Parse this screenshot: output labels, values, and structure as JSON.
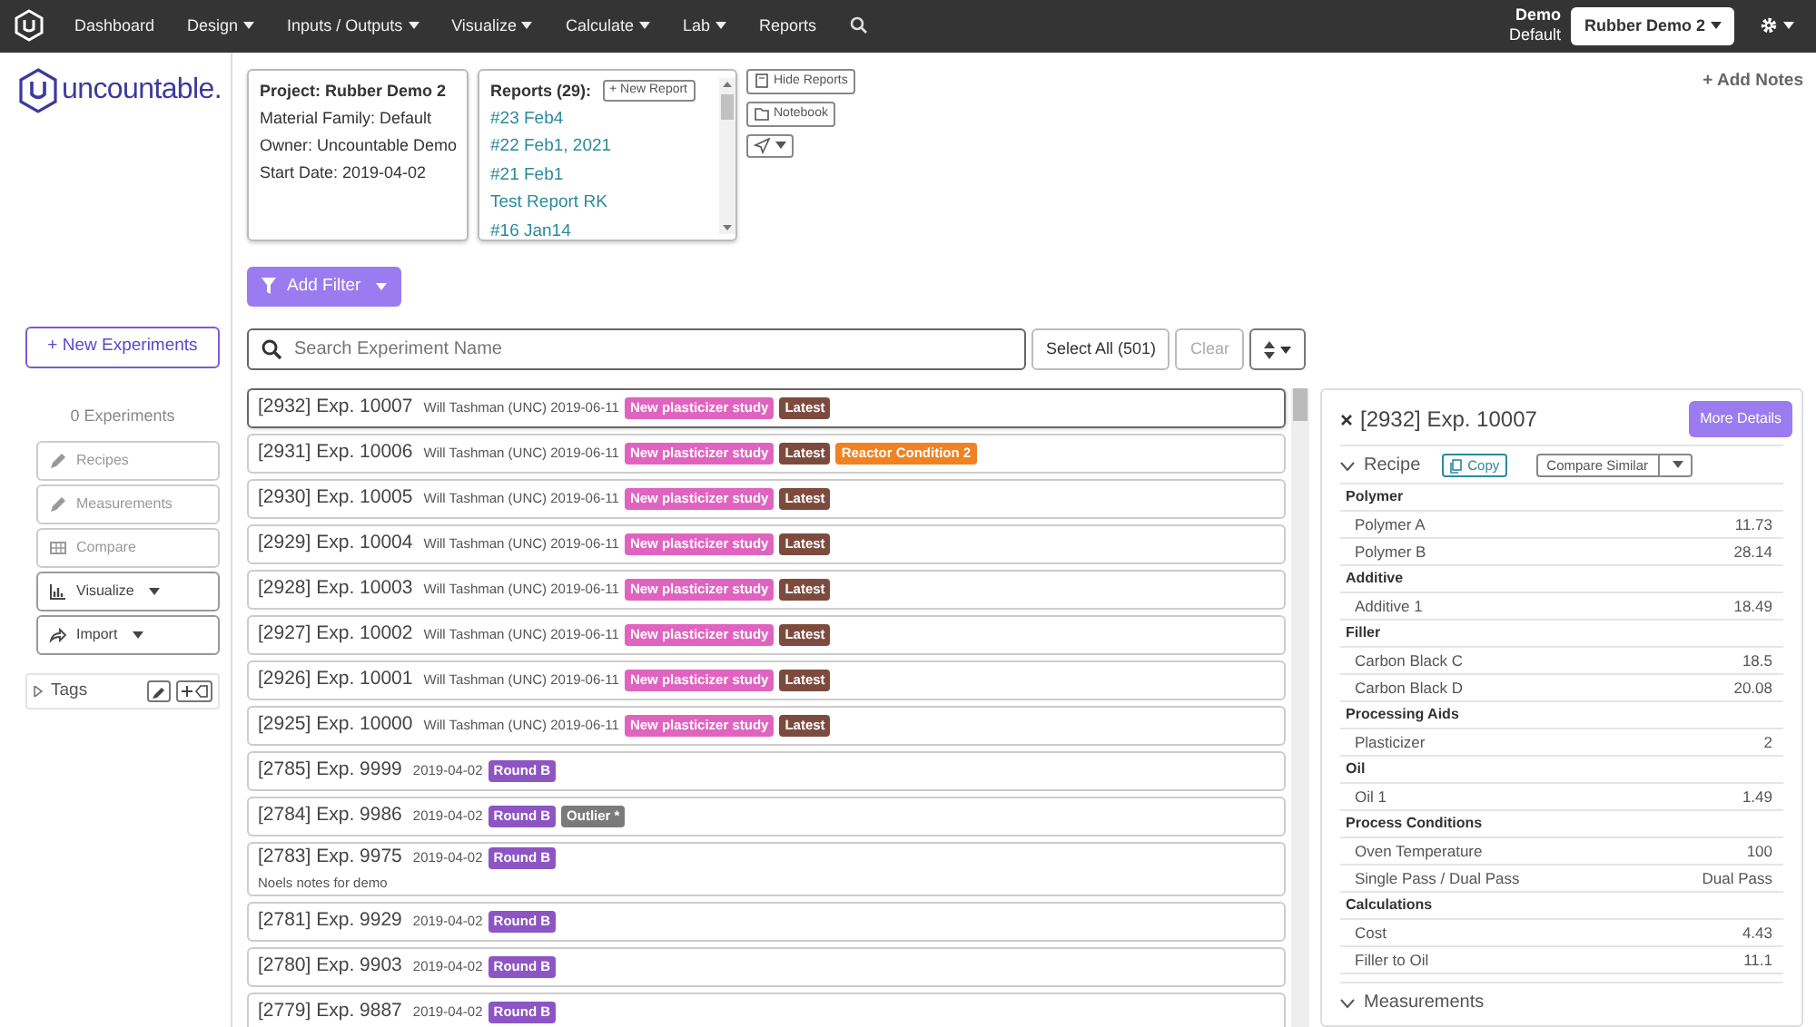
{
  "navbar": {
    "items": [
      {
        "label": "Dashboard",
        "dropdown": false
      },
      {
        "label": "Design",
        "dropdown": true
      },
      {
        "label": "Inputs / Outputs",
        "dropdown": true
      },
      {
        "label": "Visualize",
        "dropdown": true
      },
      {
        "label": "Calculate",
        "dropdown": true
      },
      {
        "label": "Lab",
        "dropdown": true
      },
      {
        "label": "Reports",
        "dropdown": false
      }
    ],
    "user": {
      "name": "Demo",
      "org": "Default"
    },
    "project_select": "Rubber Demo 2"
  },
  "logo": {
    "text": "uncountable."
  },
  "project": {
    "title": "Project: Rubber Demo 2",
    "lines": [
      "Material Family: Default",
      "Owner: Uncountable Demo",
      "Start Date: 2019-04-02"
    ]
  },
  "reports": {
    "title": "Reports (29):",
    "new_button": "+ New Report",
    "items": [
      "#23 Feb4",
      "#22 Feb1, 2021",
      "#21 Feb1",
      "Test Report RK",
      "#16 Jan14"
    ]
  },
  "side_buttons": [
    "Hide Reports",
    "Notebook"
  ],
  "add_notes": "+ Add Notes",
  "sidebar": {
    "new_button": "+ New Experiments",
    "count": "0 Experiments",
    "buttons": [
      {
        "label": "Recipes",
        "dropdown": false,
        "disabled": true
      },
      {
        "label": "Measurements",
        "dropdown": false,
        "disabled": true
      },
      {
        "label": "Compare",
        "dropdown": false,
        "disabled": true
      },
      {
        "label": "Visualize",
        "dropdown": true,
        "disabled": false
      },
      {
        "label": "Import",
        "dropdown": true,
        "disabled": false
      }
    ],
    "tags": {
      "label": "Tags",
      "expanded": false
    }
  },
  "filter_button": "Add Filter",
  "search": {
    "placeholder": "Search Experiment Name",
    "select_all": "Select All (501)",
    "clear": "Clear"
  },
  "experiments": [
    {
      "title": "[2932] Exp. 10007",
      "meta": "Will Tashman (UNC) 2019-06-11",
      "selected": true,
      "tags": [
        {
          "label": "New plasticizer study",
          "color": "#e063c0"
        },
        {
          "label": "Latest",
          "color": "#7d4b3e"
        }
      ]
    },
    {
      "title": "[2931] Exp. 10006",
      "meta": "Will Tashman (UNC) 2019-06-11",
      "selected": false,
      "tags": [
        {
          "label": "New plasticizer study",
          "color": "#e063c0"
        },
        {
          "label": "Latest",
          "color": "#7d4b3e"
        },
        {
          "label": "Reactor Condition 2",
          "color": "#f08221"
        }
      ]
    },
    {
      "title": "[2930] Exp. 10005",
      "meta": "Will Tashman (UNC) 2019-06-11",
      "selected": false,
      "tags": [
        {
          "label": "New plasticizer study",
          "color": "#e063c0"
        },
        {
          "label": "Latest",
          "color": "#7d4b3e"
        }
      ]
    },
    {
      "title": "[2929] Exp. 10004",
      "meta": "Will Tashman (UNC) 2019-06-11",
      "selected": false,
      "tags": [
        {
          "label": "New plasticizer study",
          "color": "#e063c0"
        },
        {
          "label": "Latest",
          "color": "#7d4b3e"
        }
      ]
    },
    {
      "title": "[2928] Exp. 10003",
      "meta": "Will Tashman (UNC) 2019-06-11",
      "selected": false,
      "tags": [
        {
          "label": "New plasticizer study",
          "color": "#e063c0"
        },
        {
          "label": "Latest",
          "color": "#7d4b3e"
        }
      ]
    },
    {
      "title": "[2927] Exp. 10002",
      "meta": "Will Tashman (UNC) 2019-06-11",
      "selected": false,
      "tags": [
        {
          "label": "New plasticizer study",
          "color": "#e063c0"
        },
        {
          "label": "Latest",
          "color": "#7d4b3e"
        }
      ]
    },
    {
      "title": "[2926] Exp. 10001",
      "meta": "Will Tashman (UNC) 2019-06-11",
      "selected": false,
      "tags": [
        {
          "label": "New plasticizer study",
          "color": "#e063c0"
        },
        {
          "label": "Latest",
          "color": "#7d4b3e"
        }
      ]
    },
    {
      "title": "[2925] Exp. 10000",
      "meta": "Will Tashman (UNC) 2019-06-11",
      "selected": false,
      "tags": [
        {
          "label": "New plasticizer study",
          "color": "#e063c0"
        },
        {
          "label": "Latest",
          "color": "#7d4b3e"
        }
      ]
    },
    {
      "title": "[2785] Exp. 9999",
      "meta": "2019-04-02",
      "selected": false,
      "tags": [
        {
          "label": "Round B",
          "color": "#8d55c4"
        }
      ]
    },
    {
      "title": "[2784] Exp. 9986",
      "meta": "2019-04-02",
      "selected": false,
      "tags": [
        {
          "label": "Round B",
          "color": "#8d55c4"
        },
        {
          "label": "Outlier *",
          "color": "#7a7a7a"
        }
      ]
    },
    {
      "title": "[2783] Exp. 9975",
      "meta": "2019-04-02",
      "selected": false,
      "note": "Noels notes for demo",
      "tags": [
        {
          "label": "Round B",
          "color": "#8d55c4"
        }
      ]
    },
    {
      "title": "[2781] Exp. 9929",
      "meta": "2019-04-02",
      "selected": false,
      "tags": [
        {
          "label": "Round B",
          "color": "#8d55c4"
        }
      ]
    },
    {
      "title": "[2780] Exp. 9903",
      "meta": "2019-04-02",
      "selected": false,
      "tags": [
        {
          "label": "Round B",
          "color": "#8d55c4"
        }
      ]
    },
    {
      "title": "[2779] Exp. 9887",
      "meta": "2019-04-02",
      "selected": false,
      "tags": [
        {
          "label": "Round B",
          "color": "#8d55c4"
        }
      ]
    }
  ],
  "detail": {
    "title": "[2932] Exp. 10007",
    "more_button": "More Details",
    "sections": [
      {
        "title": "Recipe",
        "expanded": true,
        "copy_button": "Copy",
        "compare_button": "Compare Similar",
        "groups": [
          {
            "name": "Polymer",
            "rows": [
              {
                "label": "Polymer A",
                "value": "11.73"
              },
              {
                "label": "Polymer B",
                "value": "28.14"
              }
            ]
          },
          {
            "name": "Additive",
            "rows": [
              {
                "label": "Additive 1",
                "value": "18.49"
              }
            ]
          },
          {
            "name": "Filler",
            "rows": [
              {
                "label": "Carbon Black C",
                "value": "18.5"
              },
              {
                "label": "Carbon Black D",
                "value": "20.08"
              }
            ]
          },
          {
            "name": "Processing Aids",
            "rows": [
              {
                "label": "Plasticizer",
                "value": "2"
              }
            ]
          },
          {
            "name": "Oil",
            "rows": [
              {
                "label": "Oil 1",
                "value": "1.49"
              }
            ]
          },
          {
            "name": "Process Conditions",
            "rows": [
              {
                "label": "Oven Temperature",
                "value": "100"
              },
              {
                "label": "Single Pass / Dual Pass",
                "value": "Dual Pass"
              }
            ]
          },
          {
            "name": "Calculations",
            "rows": [
              {
                "label": "Cost",
                "value": "4.43"
              },
              {
                "label": "Filler to Oil",
                "value": "11.1"
              }
            ]
          }
        ]
      },
      {
        "title": "Measurements",
        "expanded": true
      }
    ]
  }
}
